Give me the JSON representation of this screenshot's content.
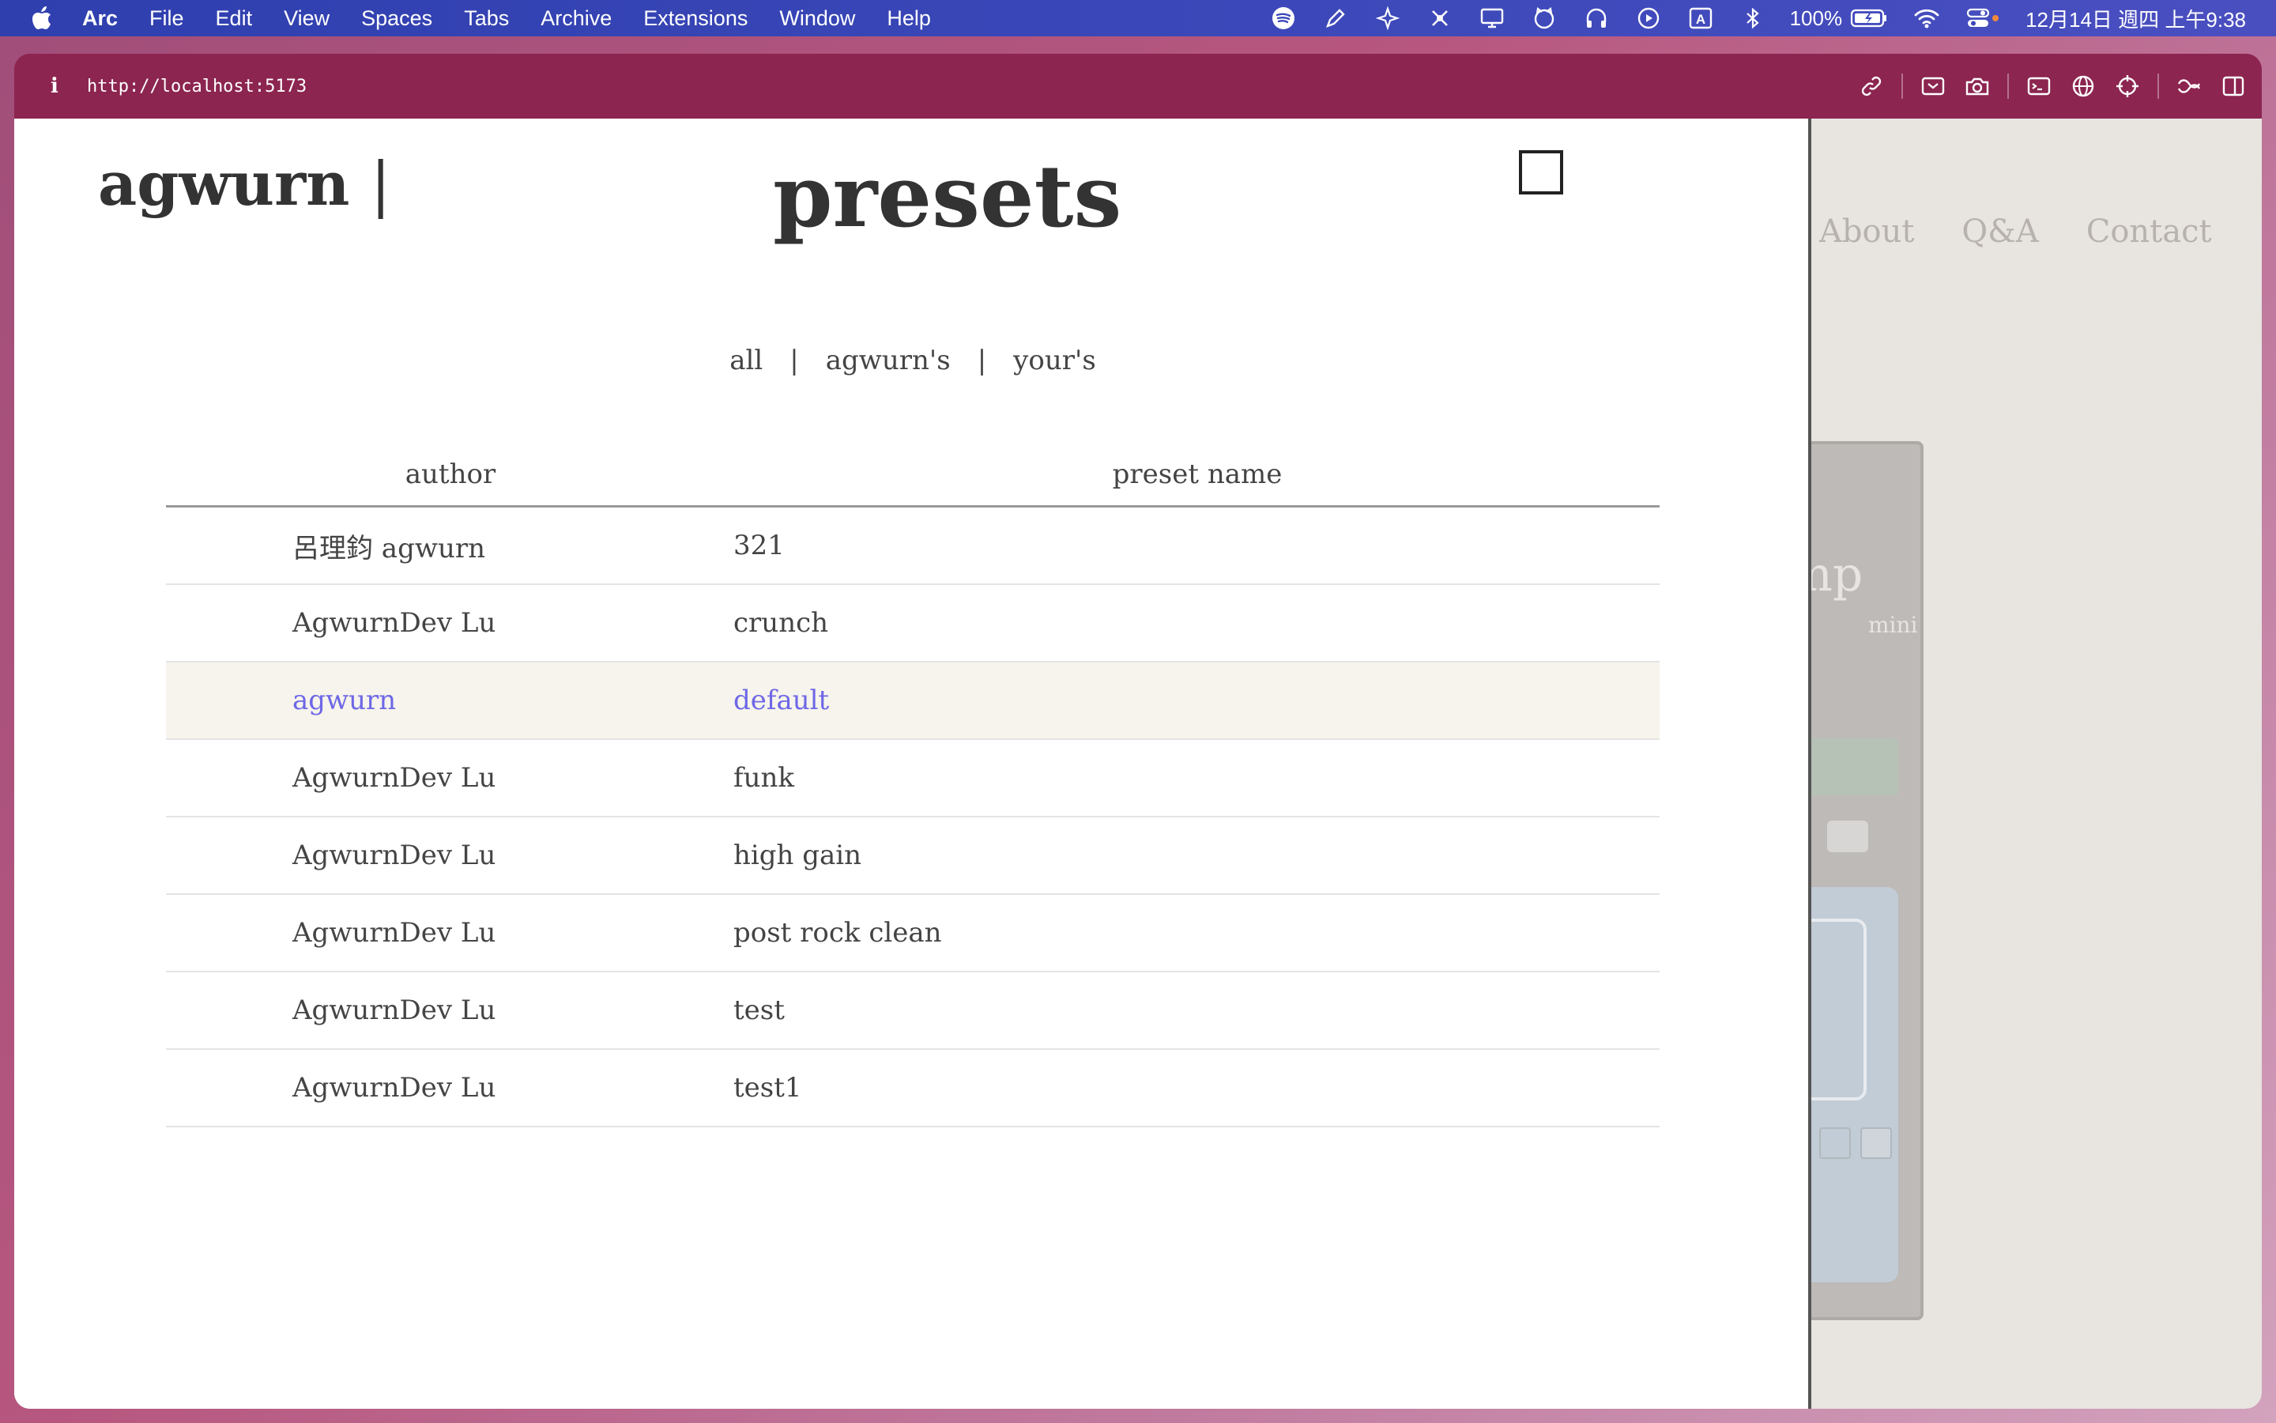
{
  "menubar": {
    "app": "Arc",
    "items": [
      "File",
      "Edit",
      "View",
      "Spaces",
      "Tabs",
      "Archive",
      "Extensions",
      "Window",
      "Help"
    ],
    "status_icons": [
      "spotify-icon",
      "pen-icon",
      "sparkle-icon",
      "drone-icon",
      "display-icon",
      "cat-icon",
      "headphones-icon",
      "play-icon",
      "input-source-icon",
      "bluetooth-icon"
    ],
    "battery": "100%",
    "datetime": "12月14日 週四 上午9:38"
  },
  "browser": {
    "url": "http://localhost:5173",
    "tools": [
      "link-icon",
      "capture-icon",
      "camera-icon",
      "terminal-icon",
      "globe-icon",
      "crosshair-icon",
      "extensions-icon",
      "sidebar-icon"
    ]
  },
  "background_page": {
    "nav": [
      "About",
      "Q&A",
      "Contact"
    ],
    "device_brand": "mp",
    "device_sub": "mini"
  },
  "drawer": {
    "logo": "agwurn",
    "logo_bar": "|",
    "title": "presets",
    "filters": {
      "all": "all",
      "divider": "|",
      "agwurns": "agwurn's",
      "yours": "your's"
    },
    "table": {
      "headers": {
        "author": "author",
        "name": "preset name"
      },
      "rows": [
        {
          "author": "呂理鈞 agwurn",
          "name": "321"
        },
        {
          "author": "AgwurnDev Lu",
          "name": "crunch"
        },
        {
          "author": "agwurn",
          "name": "default"
        },
        {
          "author": "AgwurnDev Lu",
          "name": "funk"
        },
        {
          "author": "AgwurnDev Lu",
          "name": "high gain"
        },
        {
          "author": "AgwurnDev Lu",
          "name": "post rock clean"
        },
        {
          "author": "AgwurnDev Lu",
          "name": "test"
        },
        {
          "author": "AgwurnDev Lu",
          "name": "test1"
        }
      ],
      "selected_row": "default"
    }
  },
  "colors": {
    "menubar": "#3a47b8",
    "browser_frame": "#8c2550",
    "selected_row_bg": "#f6f4ec",
    "selected_row_text": "#6e67e6"
  }
}
